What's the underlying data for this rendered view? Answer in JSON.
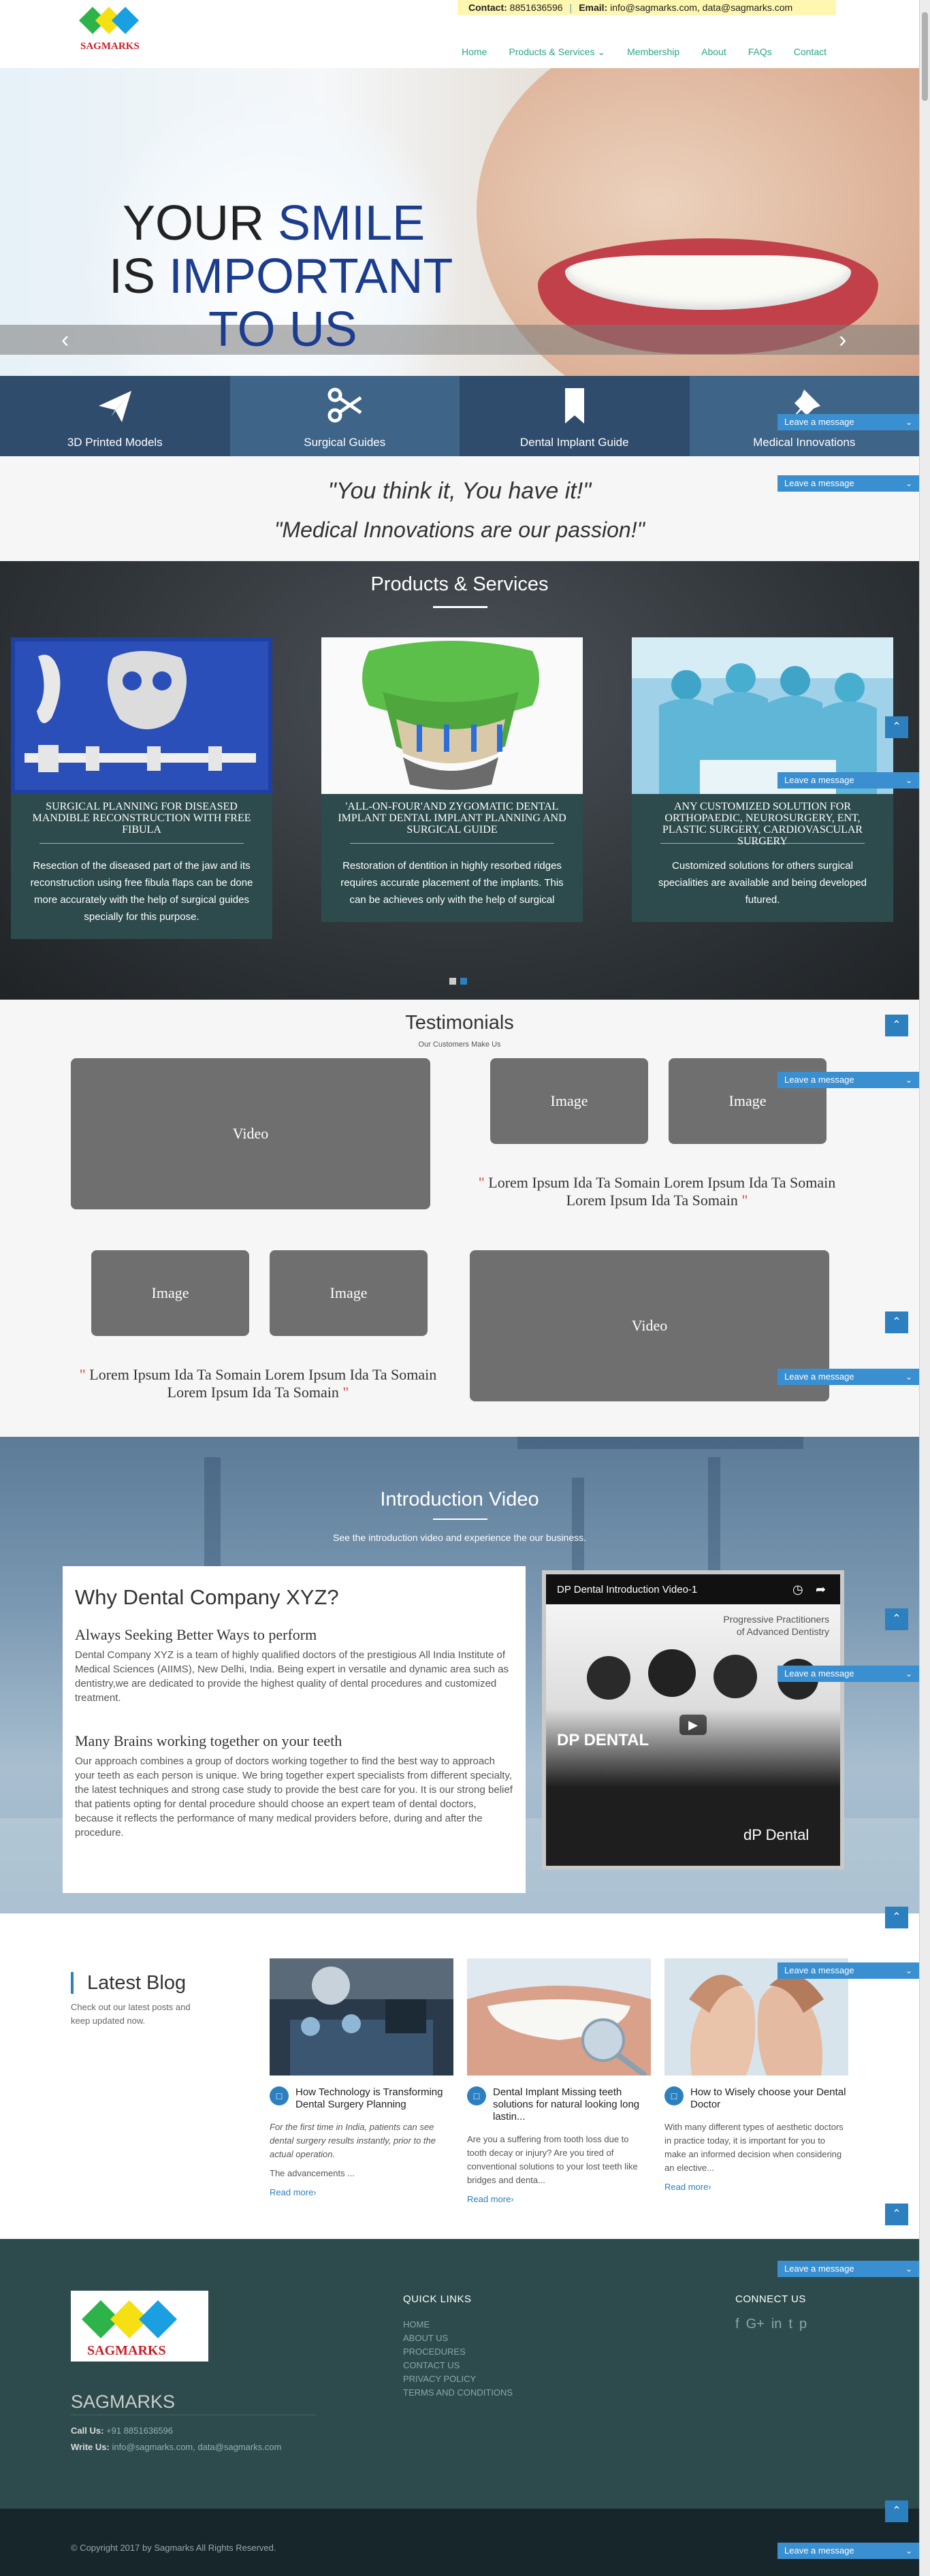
{
  "header": {
    "contact_label": "Contact:",
    "contact_phone": "8851636596",
    "email_label": "Email:",
    "email_value": "info@sagmarks.com, data@sagmarks.com",
    "logo_text": "SAGMARKS",
    "nav": [
      "Home",
      "Products & Services",
      "Membership",
      "About",
      "FAQs",
      "Contact"
    ]
  },
  "hero": {
    "line1a": "YOUR ",
    "line1b": "SMILE",
    "line2a": "IS ",
    "line2b": "IMPORTANT",
    "line3": "TO US"
  },
  "features": [
    {
      "label": "3D Printed Models",
      "icon": "paper-plane-icon"
    },
    {
      "label": "Surgical Guides",
      "icon": "scissors-icon"
    },
    {
      "label": "Dental Implant Guide",
      "icon": "bookmark-icon"
    },
    {
      "label": "Medical Innovations",
      "icon": "pin-icon"
    }
  ],
  "quotes": {
    "q1": "\"You think it, You have it!\"",
    "q2": "\"Medical Innovations are our passion!\""
  },
  "products": {
    "title": "Products & Services",
    "cards": [
      {
        "title": "SURGICAL PLANNING FOR DISEASED MANDIBLE RECONSTRUCTION WITH FREE FIBULA",
        "desc": "Resection of the diseased part of the jaw and its reconstruction using free fibula flaps can be done more accurately with the help of surgical guides specially for this purpose."
      },
      {
        "title": "'ALL-ON-FOUR'AND ZYGOMATIC DENTAL IMPLANT DENTAL IMPLANT PLANNING AND SURGICAL GUIDE",
        "desc": "Restoration of dentition in highly resorbed ridges requires accurate placement of the implants. This can be achieves only with the help of surgical"
      },
      {
        "title": "ANY CUSTOMIZED SOLUTION FOR ORTHOPAEDIC, NEUROSURGERY, ENT, PLASTIC SURGERY, CARDIOVASCULAR SURGERY",
        "desc": "Customized solutions for others surgical specialities are available and being developed futured."
      }
    ]
  },
  "testimonials": {
    "title": "Testimonials",
    "subtitle": "Our Customers Make Us",
    "video_label": "Video",
    "image_label": "Image",
    "lorem1": "Lorem Ipsum Ida Ta Somain Lorem Ipsum Ida Ta Somain Lorem Ipsum Ida Ta Somain",
    "lorem2": "Lorem Ipsum Ida Ta Somain Lorem Ipsum Ida Ta Somain Lorem Ipsum Ida Ta Somain",
    "open_quote": "\"",
    "close_quote": "\""
  },
  "intro": {
    "title": "Introduction Video",
    "subtitle": "See the introduction video and experience the our business.",
    "why_title": "Why Dental Company XYZ?",
    "h1": "Always Seeking Better Ways to perform",
    "p1": "Dental Company XYZ is a team of highly qualified doctors of the prestigious All India Institute of Medical Sciences (AIIMS), New Delhi, India. Being expert in versatile and dynamic area such as dentistry,we are dedicated to provide the highest quality of dental procedures and customized treatment.",
    "h2": "Many Brains working together on your teeth",
    "p2": "Our approach combines a group of doctors working together to find the best way to approach your teeth as each person is unique. We bring together expert specialists from different specialty, the latest techniques and strong case study to provide the best care for you. It is our strong belief that patients opting for dental procedure should choose an expert team of dental doctors, because it reflects the performance of many medical providers before, during and after the procedure.",
    "video_title": "DP Dental Introduction Video-1",
    "video_overlay1": "Progressive Practitioners",
    "video_overlay2": "of Advanced Dentistry",
    "video_brand": "DP DENTAL",
    "video_brand2": "dP Dental"
  },
  "blog": {
    "title": "Latest Blog",
    "desc": "Check out our latest posts and keep updated now.",
    "posts": [
      {
        "title": "How Technology is Transforming Dental Surgery Planning",
        "body": "For the first time in India, patients can see dental surgery results instantly, prior to the actual operation.",
        "body2": "The advancements ...",
        "more": "Read more›"
      },
      {
        "title": "Dental Implant Missing teeth solutions for natural looking long lastin...",
        "body": "Are you a suffering from tooth loss due to tooth decay or injury? Are you tired of conventional solutions to your lost teeth like bridges and denta...",
        "body2": "",
        "more": "Read more›"
      },
      {
        "title": "How to Wisely choose your Dental Doctor",
        "body": "With many different types of aesthetic doctors in practice today, it is important for you to make an informed decision when considering an elective...",
        "body2": "",
        "more": "Read more›"
      }
    ]
  },
  "footer": {
    "brand": "SAGMARKS",
    "call_label": "Call Us:",
    "call_value": "+91 8851636596",
    "write_label": "Write Us:",
    "write_value": "info@sagmarks.com, data@sagmarks.com",
    "quick_title": "QUICK LINKS",
    "links": [
      "HOME",
      "ABOUT US",
      "PROCEDURES",
      "CONTACT US",
      "PRIVACY POLICY",
      "TERMS AND CONDITIONS"
    ],
    "connect_title": "CONNECT US",
    "social": [
      "f",
      "G+",
      "in",
      "t",
      "p"
    ],
    "copyright": "© Copyright 2017 by Sagmarks All Rights Reserved."
  },
  "chat": {
    "label": "Leave a message"
  },
  "colors": {
    "accent": "#2aa68a",
    "brand_blue": "#1c3c8e",
    "dark_teal": "#2d4b4c",
    "chat_blue": "#3a8fd0"
  }
}
